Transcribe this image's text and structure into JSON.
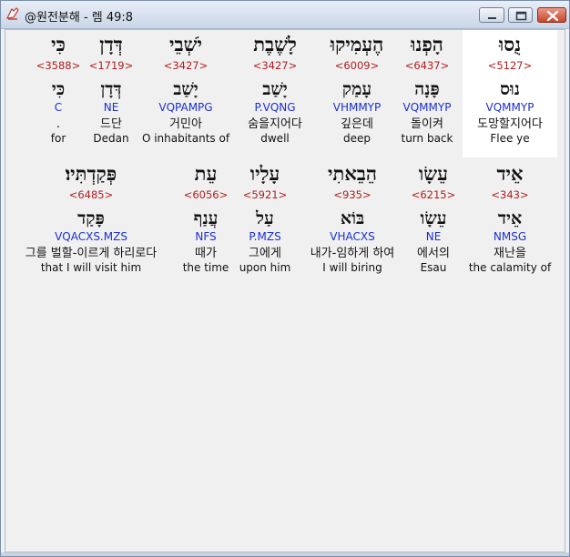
{
  "window": {
    "title": "@원전분해 - 렘 49:8",
    "icon": "app-logo-icon",
    "controls": [
      "minimize-icon",
      "maximize-icon",
      "close-icon"
    ]
  },
  "rows": [
    {
      "words": [
        {
          "heb": "נֻסוּ",
          "strong": "<5127>",
          "root": "נוּס",
          "morph": "VQMMYP",
          "kor": "도망할지어다",
          "eng": "Flee ye",
          "highlighted": true
        },
        {
          "heb": "הָפְנוּ",
          "strong": "<6437>",
          "root": "פָּנָה",
          "morph": "VQMMYP",
          "kor": "돌이켜",
          "eng": "turn back"
        },
        {
          "heb": "הֶעְמִיקוּ",
          "strong": "<6009>",
          "root": "עָמַק",
          "morph": "VHMMYP",
          "kor": "깊은데",
          "eng": "deep"
        },
        {
          "heb": "לָשֶׁבֶת",
          "strong": "<3427>",
          "root": "יָשַׁב",
          "morph": "P.VQNG",
          "kor": "숨을지어다",
          "eng": "dwell"
        },
        {
          "heb": "יֹשְׁבֵי",
          "strong": "<3427>",
          "root": "יָשַׁב",
          "morph": "VQPAMPG",
          "kor": "거민아",
          "eng": "O inhabitants of"
        },
        {
          "heb": "דְּדָן",
          "strong": "<1719>",
          "root": "דְּדָן",
          "morph": "NE",
          "kor": "드단",
          "eng": "Dedan"
        },
        {
          "heb": "כִּי",
          "strong": "<3588>",
          "root": "כִּי",
          "morph": "C",
          "kor": ".",
          "eng": "for"
        }
      ]
    },
    {
      "words": [
        {
          "heb": "אֵיד",
          "strong": "<343>",
          "root": "אֵיד",
          "morph": "NMSG",
          "kor": "재난을",
          "eng": "the calamity of"
        },
        {
          "heb": "עֵשָׂו",
          "strong": "<6215>",
          "root": "עֵשָׂו",
          "morph": "NE",
          "kor": "에서의",
          "eng": "Esau"
        },
        {
          "heb": "הֵבֵאתִי",
          "strong": "<935>",
          "root": "בּוֹא",
          "morph": "VHACXS",
          "kor": "내가-임하게 하여",
          "eng": "I will biring"
        },
        {
          "heb": "עָלָיו",
          "strong": "<5921>",
          "root": "עַל",
          "morph": "P.MZS",
          "kor": "그에게",
          "eng": "upon him"
        },
        {
          "heb": "עֵת",
          "strong": "<6056>",
          "root": "עֲנַף",
          "morph": "NFS",
          "kor": "때가",
          "eng": "the time"
        },
        {
          "heb": "פְּקַדְתִּיו׃",
          "strong": "<6485>",
          "root": "פָּקַד",
          "morph": "VQACXS.MZS",
          "kor": "그를 벌할-이르게 하리로다",
          "eng": "that I will visit him"
        }
      ]
    }
  ]
}
